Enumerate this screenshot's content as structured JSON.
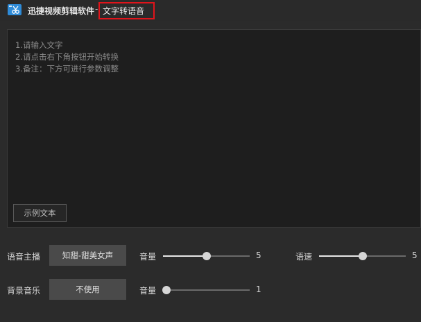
{
  "titlebar": {
    "app_name": "迅捷视频剪辑软件",
    "separator": "-",
    "page_title": "文字转语音"
  },
  "editor": {
    "hints": [
      "1.请输入文字",
      "2.请点击右下角按钮开始转换",
      "3.备注：下方可进行参数调整"
    ],
    "example_button": "示例文本"
  },
  "controls": {
    "voice_label": "语音主播",
    "voice_value": "知甜-甜美女声",
    "volume_label": "音量",
    "volume_value": "5",
    "volume_level": 0.5,
    "speed_label": "语速",
    "speed_value": "5",
    "speed_level": 0.5,
    "bgm_label": "背景音乐",
    "bgm_value": "不使用",
    "bgm_volume_label": "音量",
    "bgm_volume_value": "1",
    "bgm_volume_level": 0.0
  },
  "colors": {
    "highlight_border": "#e0141b",
    "logo_blue": "#2e8bd8"
  },
  "icons": {
    "app_logo": "scissors-film-icon"
  }
}
